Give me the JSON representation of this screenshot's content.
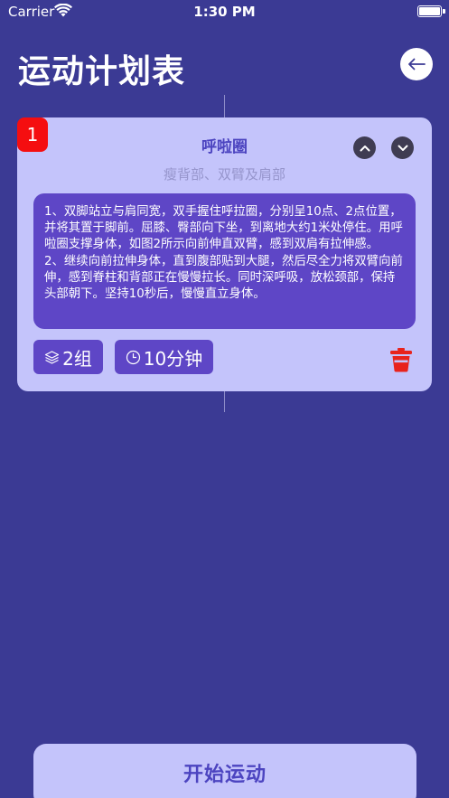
{
  "status_bar": {
    "carrier": "Carrier",
    "time": "1:30 PM"
  },
  "header": {
    "title": "运动计划表",
    "back_icon": "arrow-left-icon"
  },
  "exercise_card": {
    "index": "1",
    "title": "呼啦圈",
    "target_areas": "瘦背部、双臂及肩部",
    "description": "1、双脚站立与肩同宽，双手握住呼拉圈，分别呈10点、2点位置，并将其置于脚前。屈膝、臀部向下坐，到离地大约1米处停住。用呼啦圈支撑身体，如图2所示向前伸直双臂，感到双肩有拉伸感。\n2、继续向前拉伸身体，直到腹部贴到大腿，然后尽全力将双臂向前伸，感到脊柱和背部正在慢慢拉长。同时深呼吸，放松颈部，保持头部朝下。坚持10秒后，慢慢直立身体。",
    "sets": "2组",
    "duration": "10分钟"
  },
  "start_button": {
    "label": "开始运动"
  },
  "colors": {
    "background": "#3b3a94",
    "card": "#c4c4fb",
    "accent": "#5e46c6",
    "title_text": "#4c44c0",
    "badge": "#f50e10",
    "delete": "#e8231c"
  }
}
